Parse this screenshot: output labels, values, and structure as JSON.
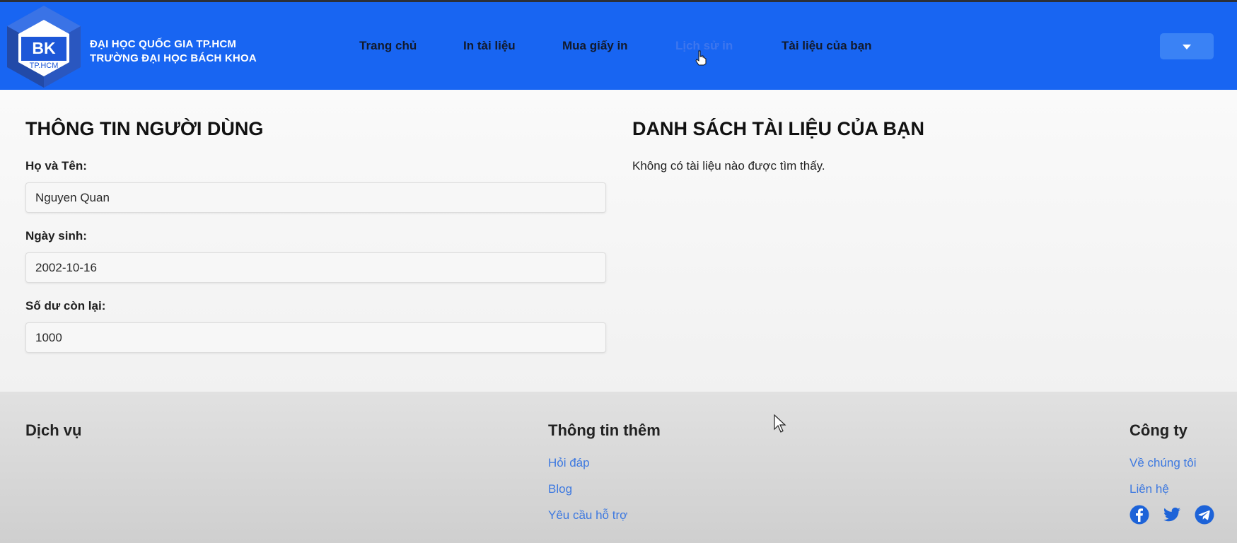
{
  "header": {
    "logo_letters": "BK",
    "logo_sub": "TP.HCM",
    "brand_line1": "ĐẠI HỌC QUỐC GIA TP.HCM",
    "brand_line2": "TRƯỜNG ĐẠI HỌC BÁCH KHOA",
    "nav": [
      {
        "label": "Trang chủ"
      },
      {
        "label": "In tài liệu"
      },
      {
        "label": "Mua giấy in"
      },
      {
        "label": "Lịch sử in"
      },
      {
        "label": "Tài liệu của bạn"
      }
    ],
    "dropdown_icon": "caret-down"
  },
  "user_info": {
    "title": "THÔNG TIN NGƯỜI DÙNG",
    "fields": [
      {
        "label": "Họ và Tên:",
        "value": "Nguyen Quan"
      },
      {
        "label": "Ngày sinh:",
        "value": "2002-10-16"
      },
      {
        "label": "Số dư còn lại:",
        "value": "1000"
      }
    ]
  },
  "documents": {
    "title": "DANH SÁCH TÀI LIỆU CỦA BẠN",
    "empty_message": "Không có tài liệu nào được tìm thấy."
  },
  "footer": {
    "services": {
      "title": "Dịch vụ"
    },
    "more_info": {
      "title": "Thông tin thêm",
      "links": [
        "Hỏi đáp",
        "Blog",
        "Yêu cầu hỗ trợ"
      ]
    },
    "company": {
      "title": "Công ty",
      "links": [
        "Về chúng tôi",
        "Liên hệ"
      ]
    },
    "social_icons": [
      "facebook-icon",
      "twitter-icon",
      "telegram-icon"
    ]
  },
  "colors": {
    "header_bg": "#1865f2",
    "link": "#3c78e0",
    "button": "#3a82f5"
  }
}
